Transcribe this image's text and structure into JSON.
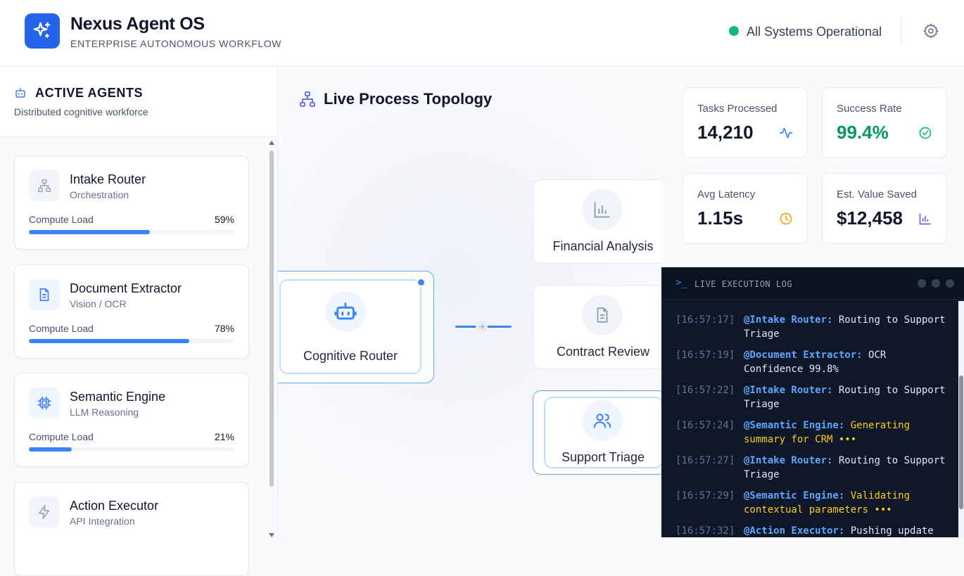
{
  "header": {
    "title": "Nexus Agent OS",
    "subtitle": "ENTERPRISE AUTONOMOUS WORKFLOW",
    "status": "All Systems Operational",
    "status_color": "#10b981",
    "brand_color": "#2563eb"
  },
  "sidebar": {
    "title": "ACTIVE AGENTS",
    "subtitle": "Distributed cognitive workforce",
    "agents": [
      {
        "name": "Intake Router",
        "type": "Orchestration",
        "load_label": "Compute Load",
        "load": "59%",
        "load_value": 59,
        "icon": "hierarchy-icon"
      },
      {
        "name": "Document Extractor",
        "type": "Vision / OCR",
        "load_label": "Compute Load",
        "load": "78%",
        "load_value": 78,
        "icon": "document-icon"
      },
      {
        "name": "Semantic Engine",
        "type": "LLM Reasoning",
        "load_label": "Compute Load",
        "load": "21%",
        "load_value": 21,
        "icon": "cpu-icon"
      },
      {
        "name": "Action Executor",
        "type": "API Integration",
        "icon": "lightning-icon"
      }
    ]
  },
  "topology": {
    "title": "Live Process Topology",
    "router": "Cognitive Router",
    "nodes": [
      "Financial Analysis",
      "Contract Review",
      "Support Triage"
    ]
  },
  "metrics": [
    {
      "label": "Tasks Processed",
      "value": "14,210",
      "icon": "activity-icon"
    },
    {
      "label": "Success Rate",
      "value": "99.4%",
      "icon": "check-circle-icon"
    },
    {
      "label": "Avg Latency",
      "value": "1.15s",
      "icon": "clock-icon"
    },
    {
      "label": "Est. Value Saved",
      "value": "$12,458",
      "icon": "bar-chart-icon"
    }
  ],
  "log": {
    "prompt": ">_",
    "title": "LIVE EXECUTION LOG",
    "entries": [
      {
        "time": "[16:57:17]",
        "agent": "@Intake Router:",
        "msg": "Routing to Support Triage",
        "kind": "normal"
      },
      {
        "time": "[16:57:19]",
        "agent": "@Document Extractor:",
        "msg": "OCR Confidence 99.8%",
        "kind": "normal"
      },
      {
        "time": "[16:57:22]",
        "agent": "@Intake Router:",
        "msg": "Routing to Support Triage",
        "kind": "normal"
      },
      {
        "time": "[16:57:24]",
        "agent": "@Semantic Engine:",
        "msg": "Generating summary for CRM •••",
        "kind": "warn"
      },
      {
        "time": "[16:57:27]",
        "agent": "@Intake Router:",
        "msg": "Routing to Support Triage",
        "kind": "normal"
      },
      {
        "time": "[16:57:29]",
        "agent": "@Semantic Engine:",
        "msg": "Validating contextual parameters •••",
        "kind": "warn"
      },
      {
        "time": "[16:57:32]",
        "agent": "@Action Executor:",
        "msg": "Pushing update",
        "kind": "normal"
      }
    ]
  }
}
